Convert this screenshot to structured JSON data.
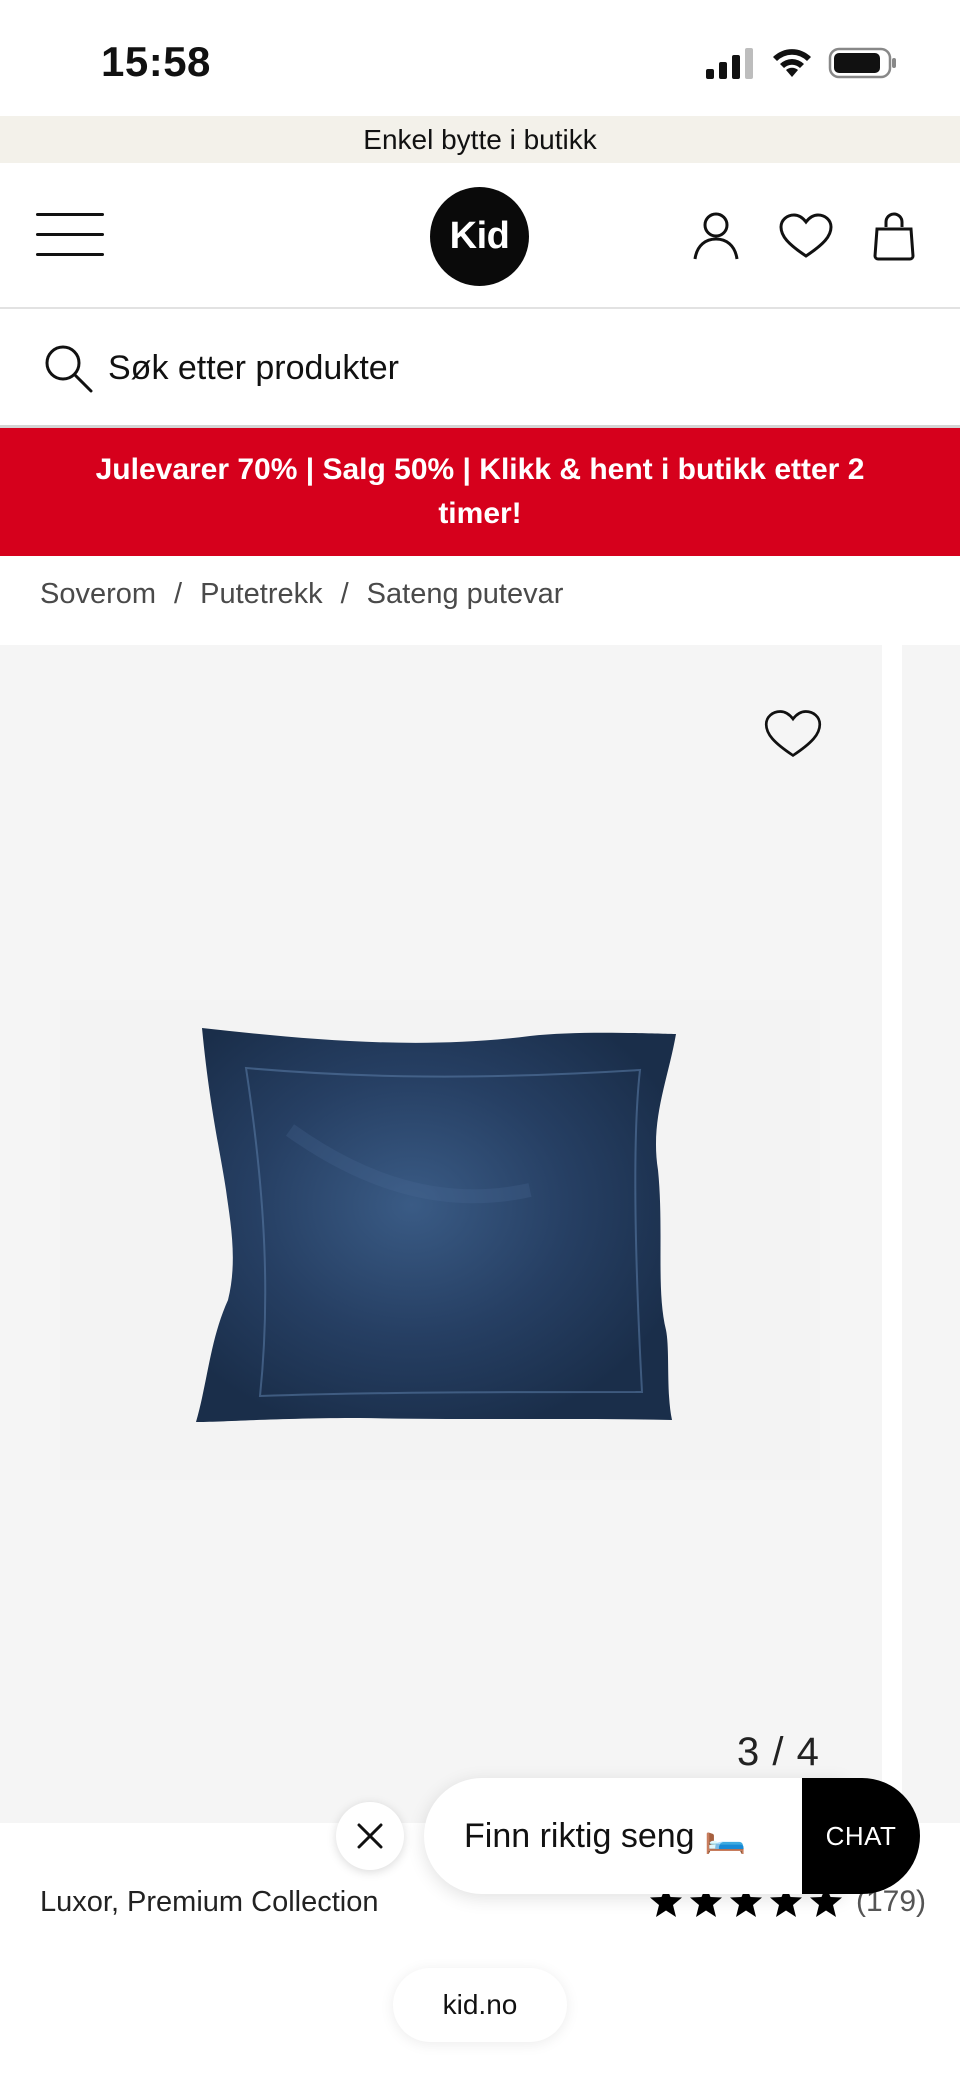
{
  "status_bar": {
    "time": "15:58"
  },
  "promo_strip": {
    "text": "Enkel bytte i butikk"
  },
  "header": {
    "logo_text": "Kid"
  },
  "search": {
    "placeholder": "Søk etter produkter"
  },
  "campaign": {
    "text": "Julevarer 70% | Salg 50% | Klikk & hent i butikk etter 2 timer!"
  },
  "breadcrumb": {
    "items": [
      "Soverom",
      "Putetrekk",
      "Sateng putevar"
    ],
    "separator": "/"
  },
  "gallery": {
    "counter": "3 / 4",
    "product_color": "#243b5a"
  },
  "product": {
    "name": "Luxor, Premium Collection",
    "rating_stars": 5,
    "rating_count": "(179)"
  },
  "chat": {
    "prompt": "Finn riktig seng 🛏️",
    "button_label": "CHAT"
  },
  "browser": {
    "url": "kid.no"
  },
  "colors": {
    "campaign_red": "#d6001c",
    "promo_bg": "#f3f1ea",
    "gallery_bg": "#f5f5f5"
  },
  "icons": [
    "signal-icon",
    "wifi-icon",
    "battery-icon",
    "menu-icon",
    "user-icon",
    "heart-icon",
    "bag-icon",
    "search-icon",
    "close-icon",
    "star-icon"
  ]
}
